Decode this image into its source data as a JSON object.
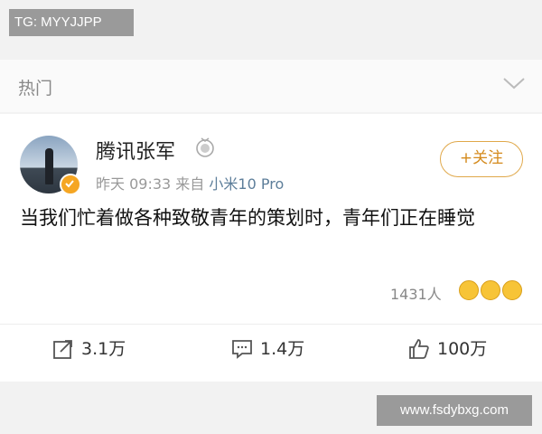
{
  "watermark_top": "TG: MYYJJPP",
  "section": {
    "label": "热门"
  },
  "post": {
    "author": "腾讯张军",
    "time": "昨天 09:33",
    "source_prefix": "来自",
    "device": "小米10 Pro",
    "follow_label": "+关注",
    "text": "当我们忙着做各种致敬青年的策划时，青年们正在睡觉",
    "reactions_count": "1431人"
  },
  "actions": {
    "repost": "3.1万",
    "comment": "1.4万",
    "like": "100万"
  },
  "watermark_bottom": "www.fsdybxg.com",
  "colors": {
    "follow_accent": "#e0a84a",
    "device_link": "#5d7e9a",
    "verified_badge": "#f5a623"
  }
}
